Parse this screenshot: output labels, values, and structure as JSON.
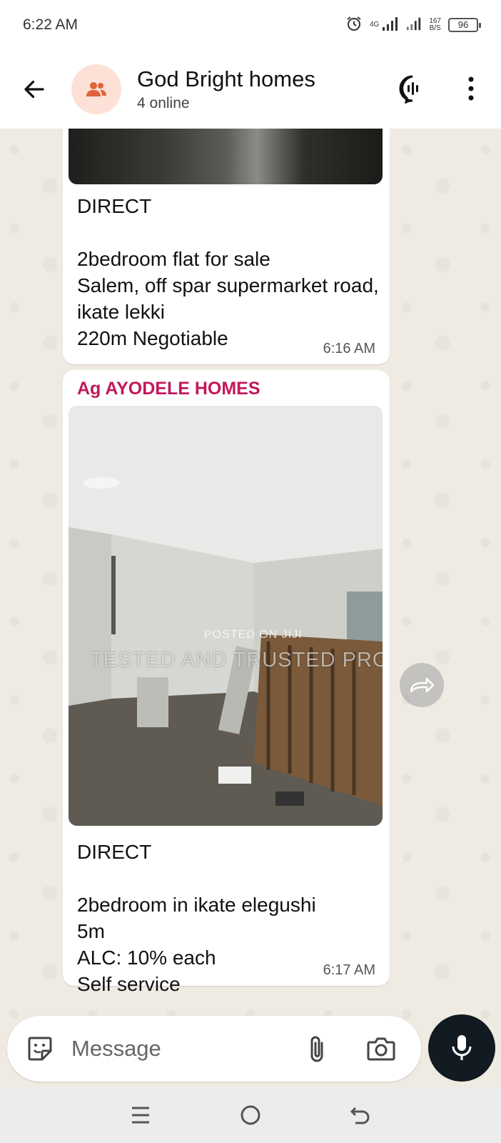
{
  "status_bar": {
    "time": "6:22 AM",
    "network": "4G",
    "speed_value": "167",
    "speed_unit": "B/S",
    "battery": "96"
  },
  "header": {
    "title": "God Bright homes",
    "subtitle": "4 online"
  },
  "messages": [
    {
      "text": "DIRECT\n\n2bedroom flat for sale\nSalem, off spar supermarket road, ikate lekki\n220m Negotiable",
      "time": "6:16 AM"
    },
    {
      "sender": "Ag AYODELE HOMES",
      "photo_watermark_small": "POSTED ON JIJI",
      "photo_watermark_large": "TESTED AND TRUSTED PROP.",
      "text": "DIRECT\n\n2bedroom in ikate elegushi\n5m\nALC: 10% each\nSelf service",
      "time": "6:17 AM"
    }
  ],
  "composer": {
    "placeholder": "Message"
  },
  "colors": {
    "sender_name": "#c2185b",
    "mic_button": "#111b21",
    "chat_background": "#efeae2",
    "avatar_background": "#fde0d6",
    "avatar_icon": "#e0643a"
  },
  "icons": {
    "back": "arrow-left-icon",
    "avatar": "group-icon",
    "voice_chat": "voice-chat-icon",
    "more": "more-vertical-icon",
    "forward": "forward-icon",
    "sticker": "sticker-icon",
    "attach": "paperclip-icon",
    "camera": "camera-icon",
    "mic": "microphone-icon",
    "nav_menu": "menu-icon",
    "nav_home": "home-circle-icon",
    "nav_back": "nav-back-icon"
  }
}
